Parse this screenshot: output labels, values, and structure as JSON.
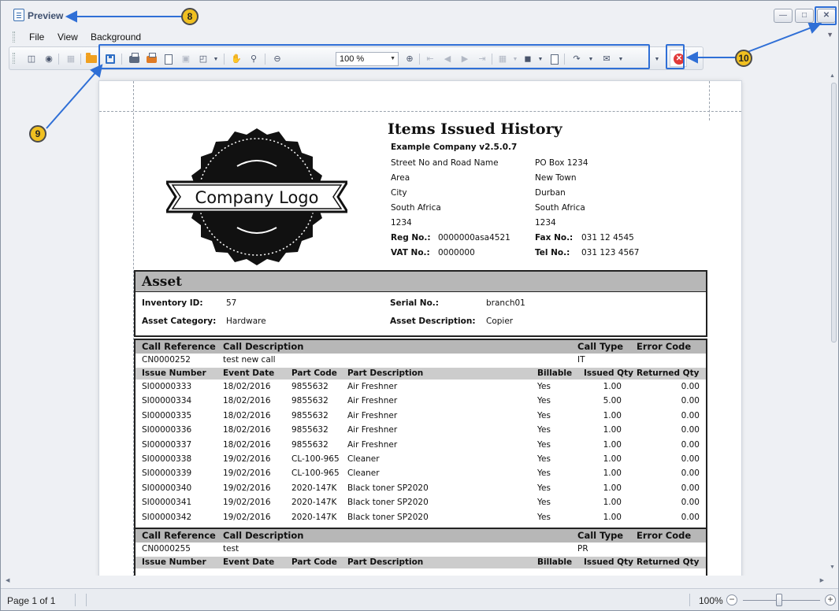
{
  "window": {
    "title": "Preview"
  },
  "menu": {
    "items": [
      "File",
      "View",
      "Background"
    ]
  },
  "toolbar": {
    "zoom_value": "100 %"
  },
  "annotations": [
    "8",
    "9",
    "10"
  ],
  "report": {
    "title": "Items Issued History",
    "company_name": "Example Company v2.5.0.7",
    "logo_text": "Company Logo",
    "street_address": [
      "Street No and Road Name",
      "Area",
      "City",
      "South Africa",
      "1234"
    ],
    "postal_address": [
      "PO Box 1234",
      "New Town",
      "Durban",
      "South Africa",
      "1234"
    ],
    "reg_label": "Reg No.:",
    "reg_value": "0000000asa4521",
    "vat_label": "VAT No.:",
    "vat_value": "0000000",
    "fax_label": "Fax No.:",
    "fax_value": "031 12 4545",
    "tel_label": "Tel No.:",
    "tel_value": "031 123 4567",
    "asset": {
      "section_title": "Asset",
      "inventory_id_label": "Inventory ID:",
      "inventory_id": "57",
      "serial_label": "Serial No.:",
      "serial": "branch01",
      "category_label": "Asset Category:",
      "category": "Hardware",
      "description_label": "Asset Description:",
      "description": "Copier"
    },
    "call_headers": [
      "Call Reference",
      "Call Description",
      "Call Type",
      "Error Code"
    ],
    "issue_headers": [
      "Issue Number",
      "Event Date",
      "Part Code",
      "Part Description",
      "Billable",
      "Issued Qty",
      "Returned Qty"
    ],
    "calls": [
      {
        "reference": "CN0000252",
        "description": "test new call",
        "type": "IT",
        "error_code": "",
        "issues": [
          [
            "SI00000333",
            "18/02/2016",
            "9855632",
            "Air Freshner",
            "Yes",
            "1.00",
            "0.00"
          ],
          [
            "SI00000334",
            "18/02/2016",
            "9855632",
            "Air Freshner",
            "Yes",
            "5.00",
            "0.00"
          ],
          [
            "SI00000335",
            "18/02/2016",
            "9855632",
            "Air Freshner",
            "Yes",
            "1.00",
            "0.00"
          ],
          [
            "SI00000336",
            "18/02/2016",
            "9855632",
            "Air Freshner",
            "Yes",
            "1.00",
            "0.00"
          ],
          [
            "SI00000337",
            "18/02/2016",
            "9855632",
            "Air Freshner",
            "Yes",
            "1.00",
            "0.00"
          ],
          [
            "SI00000338",
            "19/02/2016",
            "CL-100-965",
            "Cleaner",
            "Yes",
            "1.00",
            "0.00"
          ],
          [
            "SI00000339",
            "19/02/2016",
            "CL-100-965",
            "Cleaner",
            "Yes",
            "1.00",
            "0.00"
          ],
          [
            "SI00000340",
            "19/02/2016",
            "2020-147K",
            "Black toner SP2020",
            "Yes",
            "1.00",
            "0.00"
          ],
          [
            "SI00000341",
            "19/02/2016",
            "2020-147K",
            "Black toner SP2020",
            "Yes",
            "1.00",
            "0.00"
          ],
          [
            "SI00000342",
            "19/02/2016",
            "2020-147K",
            "Black toner SP2020",
            "Yes",
            "1.00",
            "0.00"
          ]
        ]
      },
      {
        "reference": "CN0000255",
        "description": "test",
        "type": "PR",
        "error_code": "",
        "issues": []
      }
    ]
  },
  "status": {
    "page": "Page 1 of 1",
    "zoom": "100%",
    "zoom_slider_level_percent": 42
  }
}
